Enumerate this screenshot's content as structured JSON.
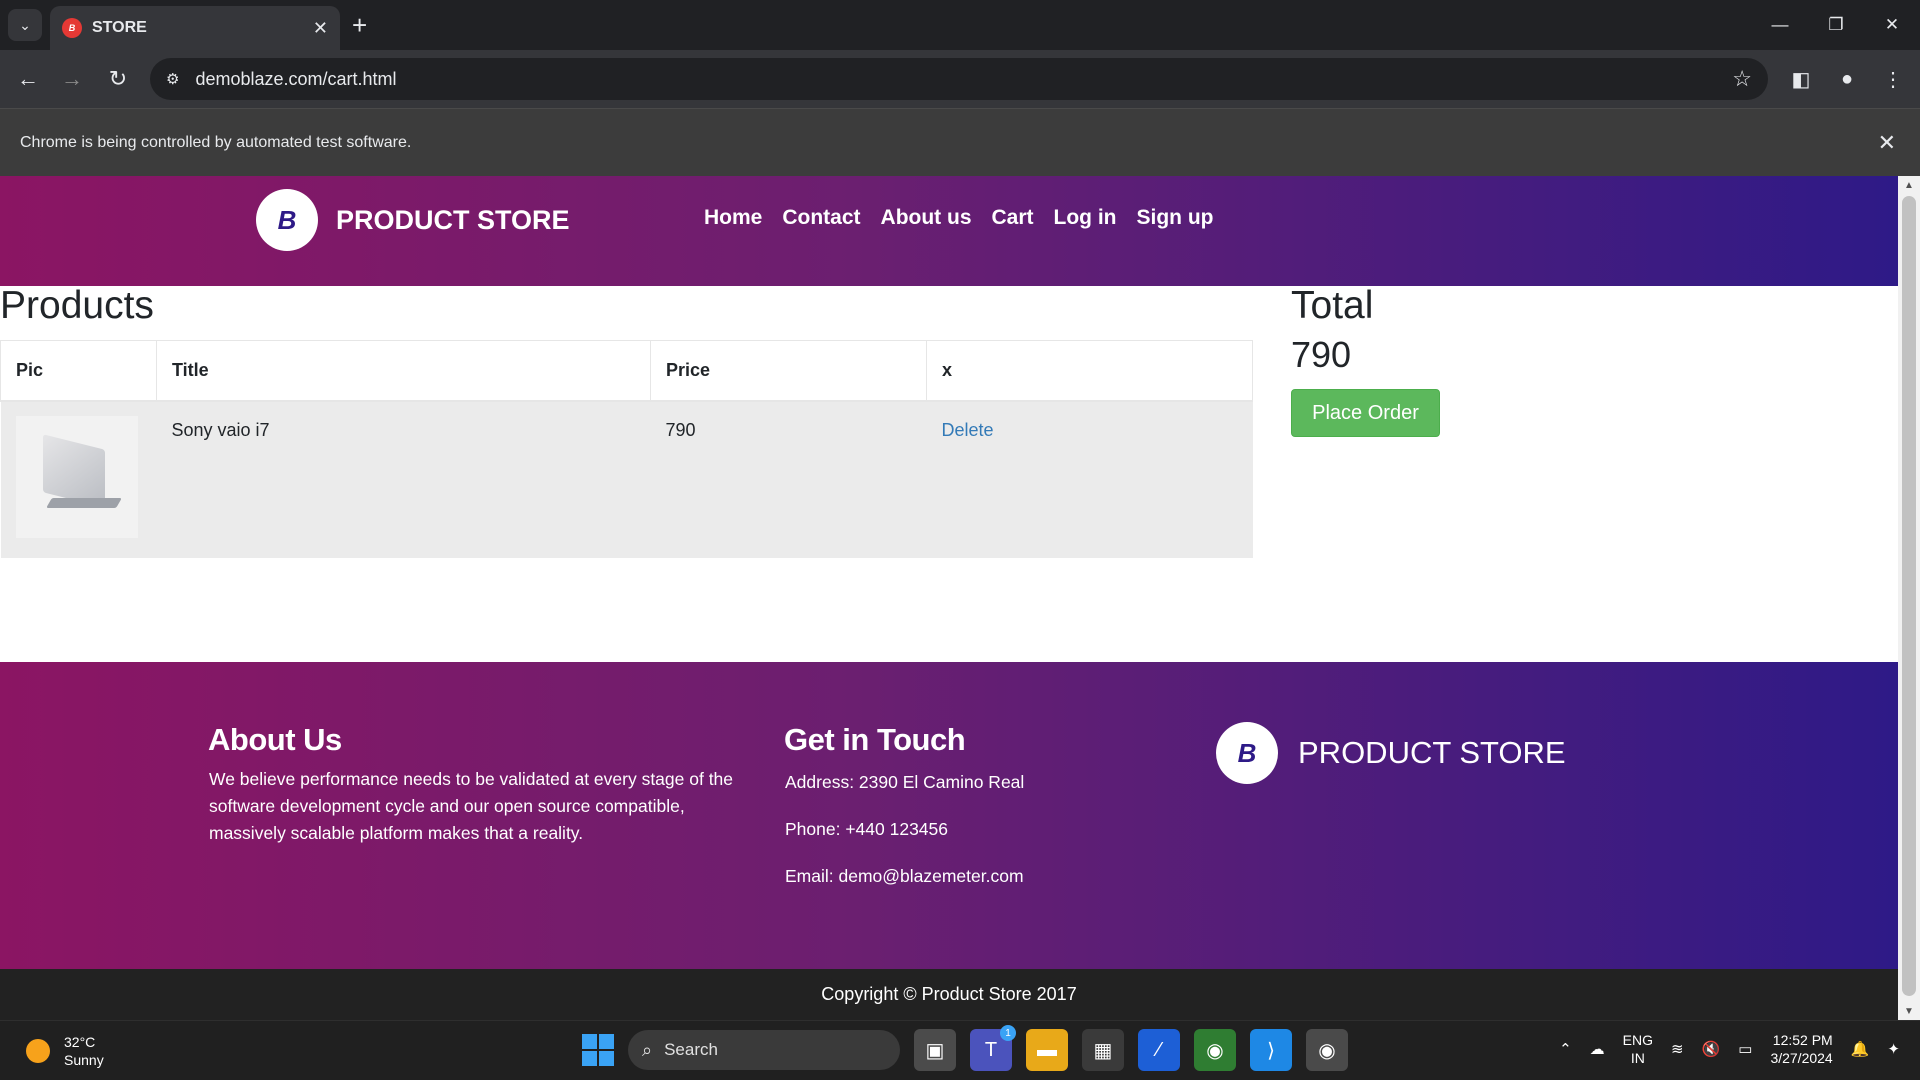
{
  "browser": {
    "tab_title": "STORE",
    "tab_favicon": "B",
    "url": "demoblaze.com/cart.html",
    "infobar_text": "Chrome is being controlled by automated test software."
  },
  "site": {
    "brand": "PRODUCT STORE",
    "logo_letter": "B",
    "nav": [
      "Home",
      "Contact",
      "About us",
      "Cart",
      "Log in",
      "Sign up"
    ]
  },
  "cart": {
    "heading": "Products",
    "columns": [
      "Pic",
      "Title",
      "Price",
      "x"
    ],
    "rows": [
      {
        "title": "Sony vaio i7",
        "price": "790",
        "action": "Delete"
      }
    ],
    "total_heading": "Total",
    "total_value": "790",
    "place_order_label": "Place Order"
  },
  "footer": {
    "about_heading": "About Us",
    "about_text": "We believe performance needs to be validated at every stage of the software development cycle and our open source compatible, massively scalable platform makes that a reality.",
    "touch_heading": "Get in Touch",
    "address": "Address: 2390 El Camino Real",
    "phone": "Phone: +440 123456",
    "email": "Email: demo@blazemeter.com",
    "brand": "PRODUCT STORE",
    "copyright": "Copyright © Product Store 2017"
  },
  "taskbar": {
    "temperature": "32°C",
    "condition": "Sunny",
    "search_label": "Search",
    "lang_top": "ENG",
    "lang_bottom": "IN",
    "time": "12:52 PM",
    "date": "3/27/2024",
    "teams_badge": "1"
  },
  "colors": {
    "header_gradient_start": "#8b1563",
    "header_gradient_end": "#2e1a87",
    "place_order": "#5cb85c",
    "link": "#337ab7"
  }
}
